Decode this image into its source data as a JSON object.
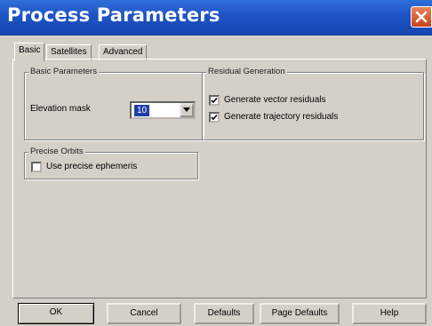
{
  "window": {
    "title": "Process Parameters"
  },
  "tabs": [
    {
      "label": "Basic",
      "active": true
    },
    {
      "label": "Satellites",
      "active": false
    },
    {
      "label": "Advanced",
      "active": false
    }
  ],
  "basic_parameters": {
    "legend": "Basic Parameters",
    "elevation_mask_label": "Elevation mask",
    "elevation_mask_value": "10"
  },
  "residual_generation": {
    "legend": "Residual Generation",
    "options": [
      {
        "label": "Generate vector residuals",
        "checked": true
      },
      {
        "label": "Generate trajectory residuals",
        "checked": true
      }
    ]
  },
  "precise_orbits": {
    "legend": "Precise Orbits",
    "option": {
      "label": "Use precise ephemeris",
      "checked": false
    }
  },
  "buttons": {
    "ok": "OK",
    "cancel": "Cancel",
    "defaults": "Defaults",
    "page_defaults": "Page Defaults",
    "help": "Help"
  },
  "colors": {
    "titlebar": "#1e52c4",
    "selection": "#1e3fa6",
    "face": "#d4d0c8"
  }
}
